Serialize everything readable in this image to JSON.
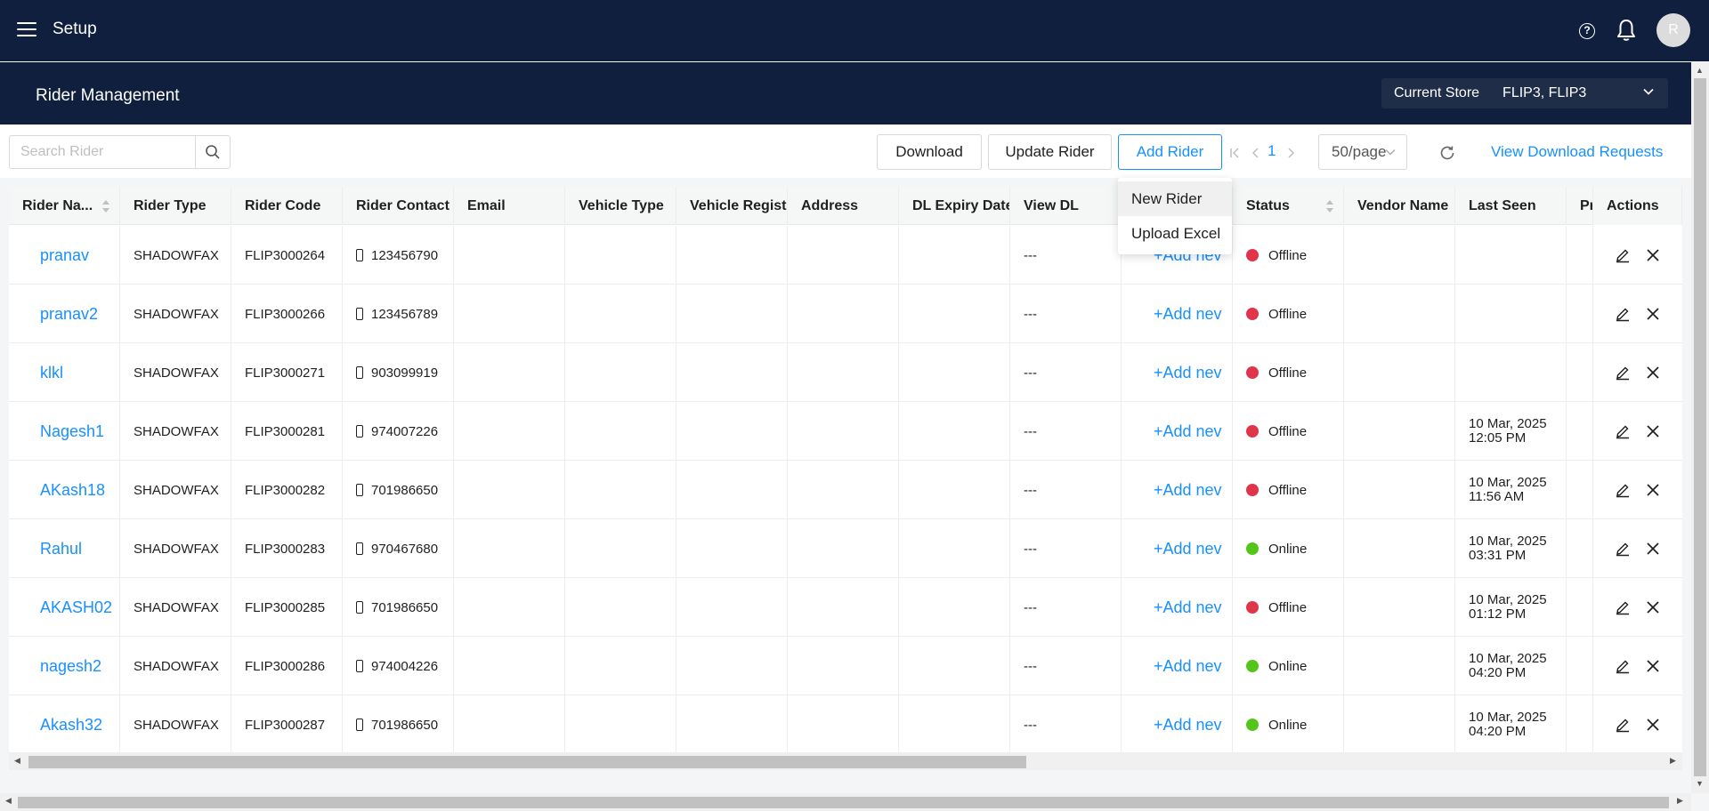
{
  "topbar": {
    "title": "Setup",
    "avatar_initial": "R",
    "help_glyph": "?"
  },
  "subheader": {
    "title": "Rider Management",
    "store_label": "Current Store",
    "store_value": "FLIP3, FLIP3"
  },
  "toolbar": {
    "search_placeholder": "Search Rider",
    "download_label": "Download",
    "update_label": "Update Rider",
    "add_label": "Add Rider",
    "current_page": "1",
    "per_page": "50/page",
    "view_requests_label": "View Download Requests"
  },
  "add_menu": {
    "options": [
      "New Rider",
      "Upload Excel"
    ]
  },
  "table": {
    "columns": [
      "Rider Na...",
      "Rider Type",
      "Rider Code",
      "Rider Contact",
      "Email",
      "Vehicle Type",
      "Vehicle Registra",
      "Address",
      "DL Expiry Date",
      "View DL",
      "",
      "Status",
      "Vendor Name",
      "Last Seen",
      "Pr",
      "Actions"
    ],
    "add_new_label": "+Add nev",
    "dl_placeholder": "---",
    "status_colors": {
      "Offline": "#e0344b",
      "Online": "#52c41a"
    },
    "rows": [
      {
        "name": "pranav",
        "type": "SHADOWFAX",
        "code": "FLIP3000264",
        "contact": "123456790",
        "status": "Offline",
        "seen_date": "",
        "seen_time": ""
      },
      {
        "name": "pranav2",
        "type": "SHADOWFAX",
        "code": "FLIP3000266",
        "contact": "123456789",
        "status": "Offline",
        "seen_date": "",
        "seen_time": ""
      },
      {
        "name": "klkl",
        "type": "SHADOWFAX",
        "code": "FLIP3000271",
        "contact": "903099919",
        "status": "Offline",
        "seen_date": "",
        "seen_time": ""
      },
      {
        "name": "Nagesh1",
        "type": "SHADOWFAX",
        "code": "FLIP3000281",
        "contact": "974007226",
        "status": "Offline",
        "seen_date": "10 Mar, 2025",
        "seen_time": "12:05 PM"
      },
      {
        "name": "AKash18",
        "type": "SHADOWFAX",
        "code": "FLIP3000282",
        "contact": "701986650",
        "status": "Offline",
        "seen_date": "10 Mar, 2025",
        "seen_time": "11:56 AM"
      },
      {
        "name": "Rahul",
        "type": "SHADOWFAX",
        "code": "FLIP3000283",
        "contact": "970467680",
        "status": "Online",
        "seen_date": "10 Mar, 2025",
        "seen_time": "03:31 PM"
      },
      {
        "name": "AKASH02",
        "type": "SHADOWFAX",
        "code": "FLIP3000285",
        "contact": "701986650",
        "status": "Offline",
        "seen_date": "10 Mar, 2025",
        "seen_time": "01:12 PM"
      },
      {
        "name": "nagesh2",
        "type": "SHADOWFAX",
        "code": "FLIP3000286",
        "contact": "974004226",
        "status": "Online",
        "seen_date": "10 Mar, 2025",
        "seen_time": "04:20 PM"
      },
      {
        "name": "Akash32",
        "type": "SHADOWFAX",
        "code": "FLIP3000287",
        "contact": "701986650",
        "status": "Online",
        "seen_date": "10 Mar, 2025",
        "seen_time": "04:20 PM"
      }
    ]
  }
}
